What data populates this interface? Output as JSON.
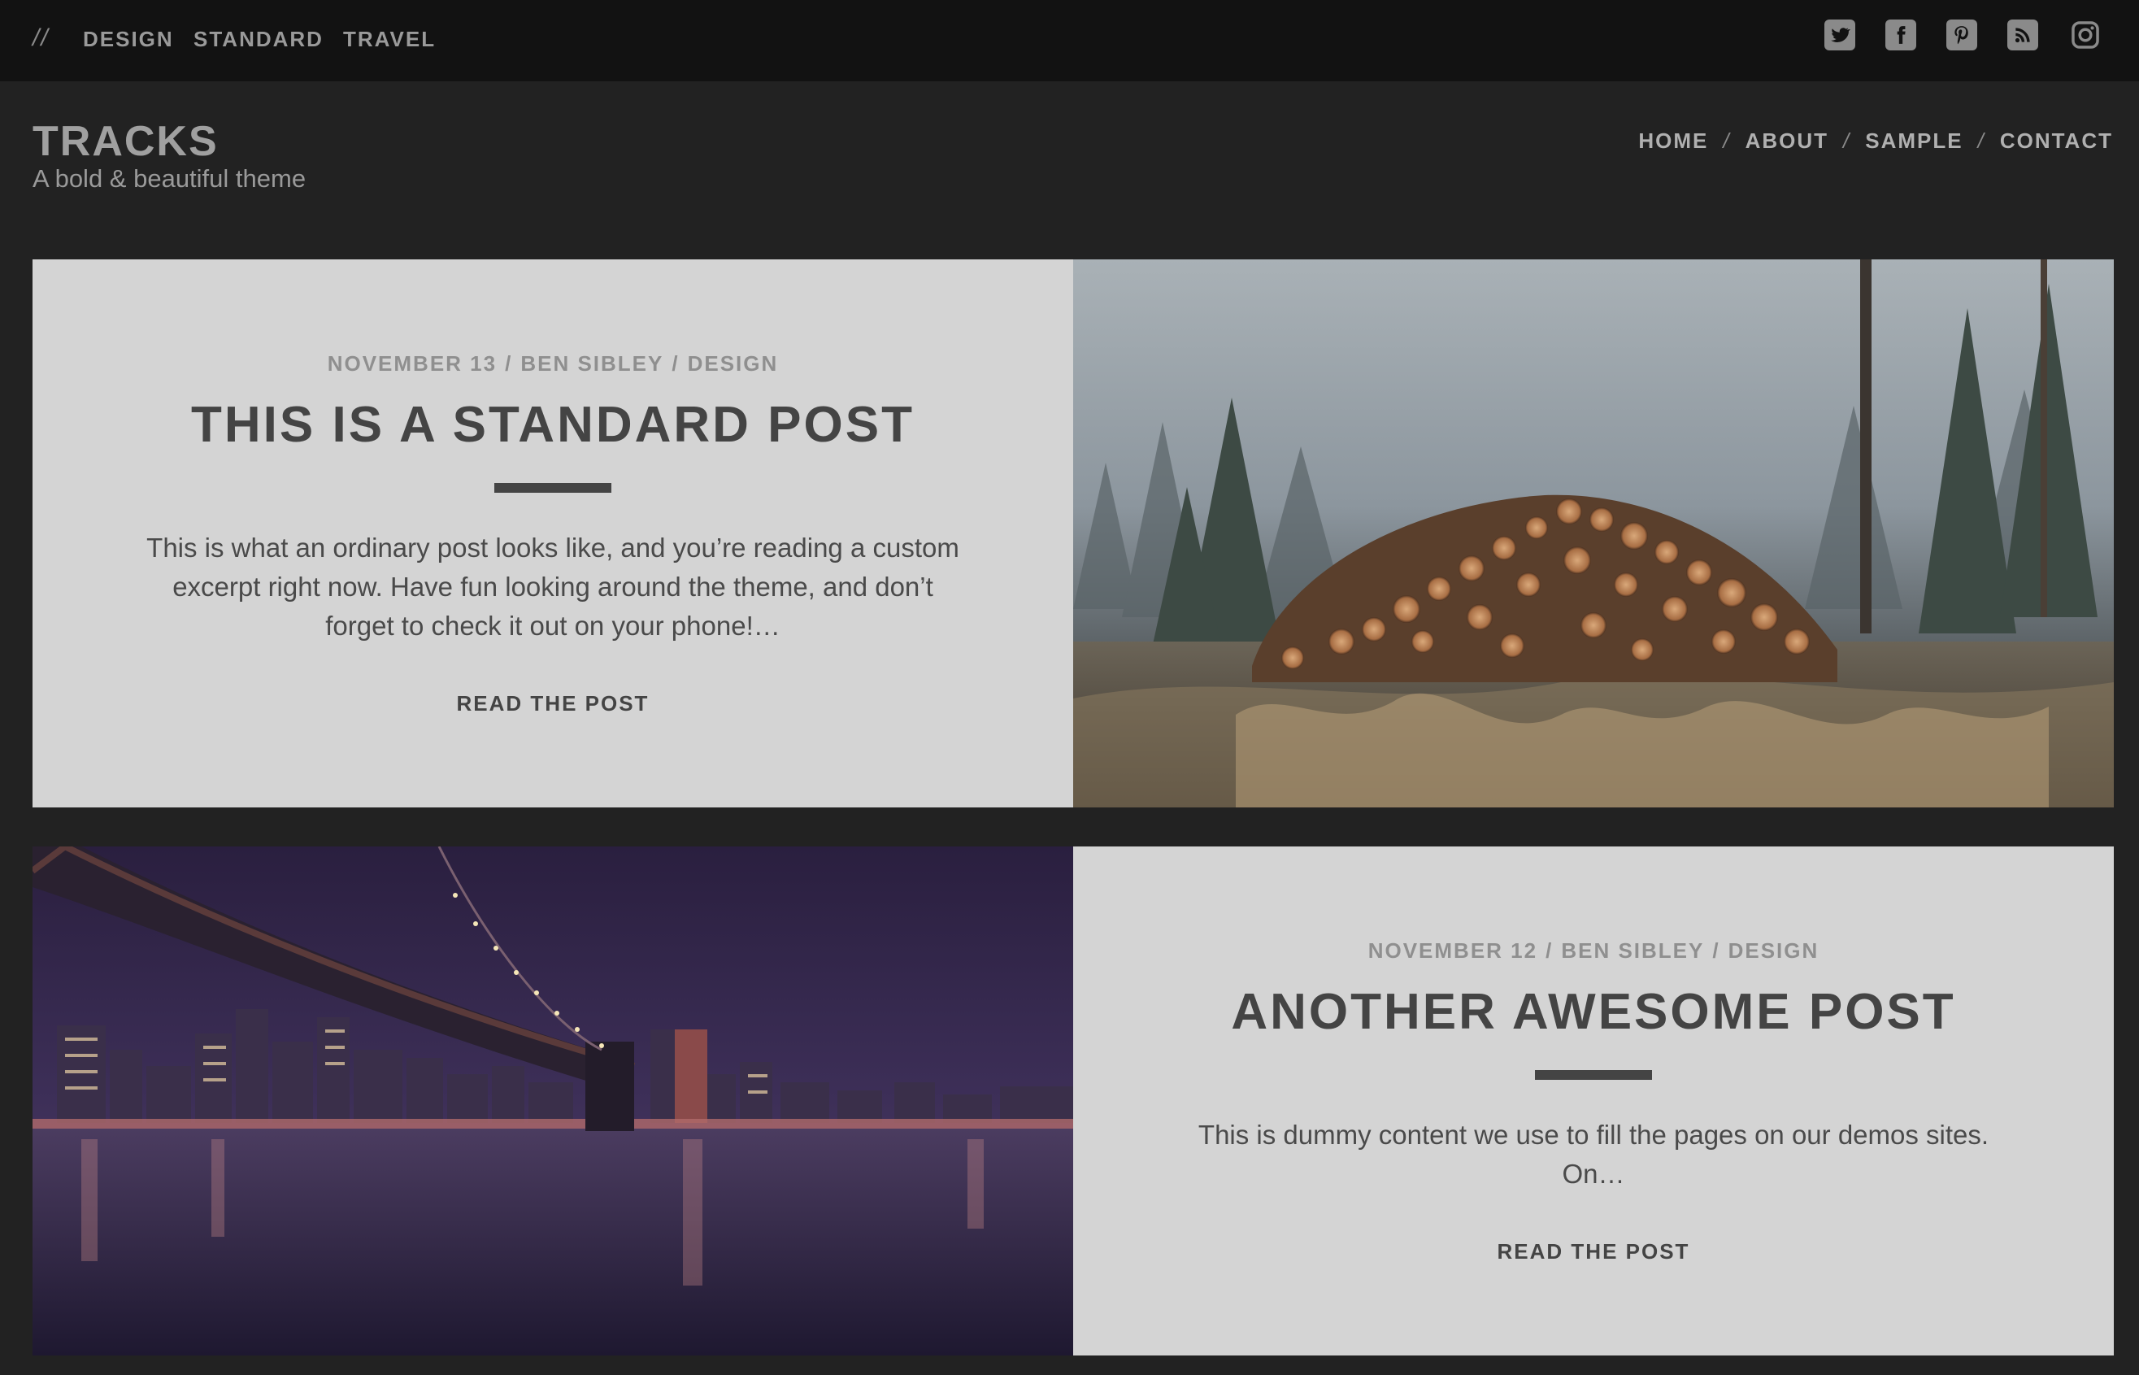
{
  "topbar": {
    "slashes": "//",
    "categories": [
      "DESIGN",
      "STANDARD",
      "TRAVEL"
    ],
    "social_icons": [
      "twitter-icon",
      "facebook-icon",
      "pinterest-icon",
      "rss-icon",
      "instagram-icon"
    ]
  },
  "header": {
    "title": "TRACKS",
    "tagline": "A bold & beautiful theme",
    "nav": [
      "HOME",
      "ABOUT",
      "SAMPLE",
      "CONTACT"
    ],
    "nav_separator": "/"
  },
  "posts": [
    {
      "date": "NOVEMBER 13",
      "author": "BEN SIBLEY",
      "category": "DESIGN",
      "meta_separator": "/",
      "title": "THIS IS A STANDARD POST",
      "excerpt": "This is what an ordinary post looks like, and you’re reading a custom excerpt right now. Have fun looking around the theme, and don’t forget to check it out on your phone!…",
      "read_more": "READ THE POST",
      "image": "forest-logpile-photo"
    },
    {
      "date": "NOVEMBER 12",
      "author": "BEN SIBLEY",
      "category": "DESIGN",
      "meta_separator": "/",
      "title": "ANOTHER AWESOME POST",
      "excerpt": "This is dummy content we use to fill the pages on our demos sites. On…",
      "read_more": "READ THE POST",
      "image": "bridge-city-night-photo"
    }
  ],
  "colors": {
    "page_bg": "#222222",
    "topbar_bg": "#121212",
    "card_bg": "#d4d4d4",
    "title_text": "#444444"
  }
}
